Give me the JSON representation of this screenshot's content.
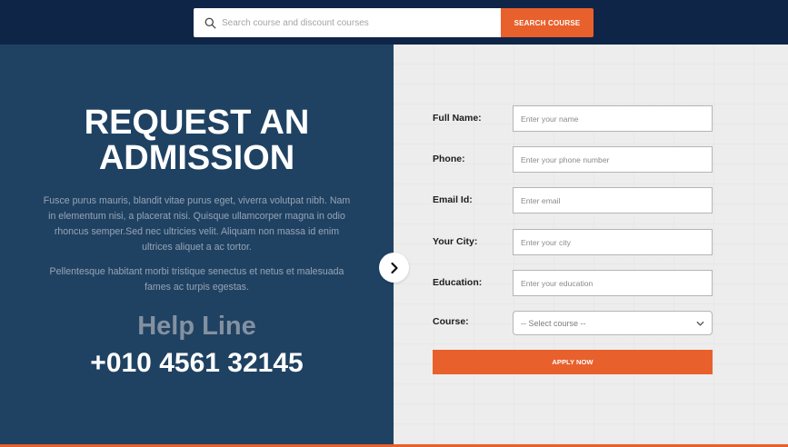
{
  "search": {
    "placeholder": "Search course and discount courses",
    "button_label": "SEARCH COURSE"
  },
  "hero": {
    "title_line1": "REQUEST AN",
    "title_line2": "ADMISSION",
    "paragraph1": "Fusce purus mauris, blandit vitae purus eget, viverra volutpat nibh. Nam in elementum nisi, a placerat nisi. Quisque ullamcorper magna in odio rhoncus semper.Sed nec ultricies velit. Aliquam non massa id enim ultrices aliquet a ac tortor.",
    "paragraph2": "Pellentesque habitant morbi tristique senectus et netus et malesuada fames ac turpis egestas.",
    "help_label": "Help Line",
    "help_phone": "+010 4561 32145"
  },
  "form": {
    "fields": [
      {
        "label": "Full Name:",
        "placeholder": "Enter your name"
      },
      {
        "label": "Phone:",
        "placeholder": "Enter your phone number"
      },
      {
        "label": "Email Id:",
        "placeholder": "Enter email"
      },
      {
        "label": "Your City:",
        "placeholder": "Enter your city"
      },
      {
        "label": "Education:",
        "placeholder": "Enter your education"
      }
    ],
    "course_label": "Course:",
    "course_selected": "-- Select course --",
    "apply_label": "APPLY NOW"
  },
  "icons": {
    "search": "search-icon",
    "dropdown": "chevron-down-icon",
    "next": "chevron-right-icon"
  },
  "colors": {
    "topbar": "#0f2548",
    "panel": "#1f4263",
    "accent": "#e8602c"
  }
}
